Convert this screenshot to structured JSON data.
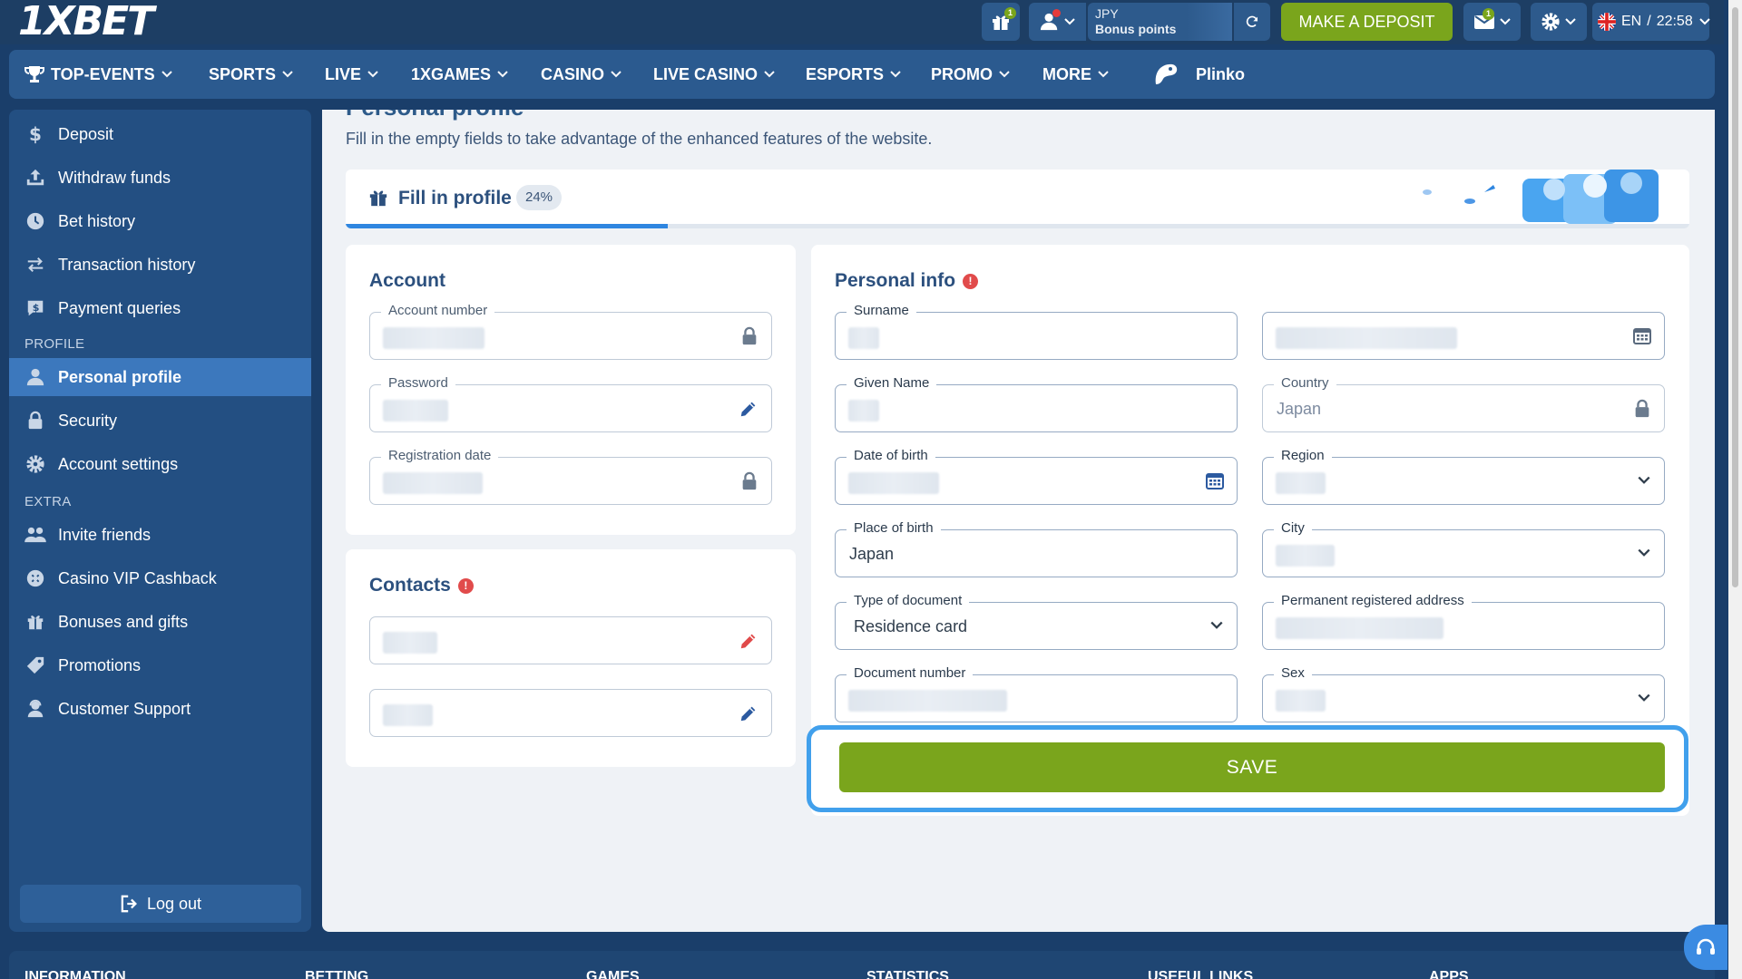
{
  "brand": {
    "logo": "1XBET"
  },
  "header": {
    "gift_badge": "1",
    "balance_currency": "JPY",
    "balance_label": "Bonus points",
    "deposit_label": "MAKE A DEPOSIT",
    "mail_badge": "1",
    "language": "EN",
    "separator": "/",
    "time": "22:58"
  },
  "nav": {
    "items": [
      "TOP-EVENTS",
      "SPORTS",
      "LIVE",
      "1XGAMES",
      "CASINO",
      "LIVE CASINO",
      "ESPORTS",
      "PROMO",
      "MORE"
    ],
    "plinko": "Plinko"
  },
  "sidebar": {
    "items": [
      "Deposit",
      "Withdraw funds",
      "Bet history",
      "Transaction history",
      "Payment queries"
    ],
    "profile_section": "PROFILE",
    "profile_items": [
      "Personal profile",
      "Security",
      "Account settings"
    ],
    "extra_section": "EXTRA",
    "extra_items": [
      "Invite friends",
      "Casino VIP Cashback",
      "Bonuses and gifts",
      "Promotions",
      "Customer Support"
    ],
    "logout": "Log out"
  },
  "main": {
    "title": "Personal profile",
    "subtitle": "Fill in the empty fields to take advantage of the enhanced features of the website.",
    "fill_profile": {
      "title": "Fill in profile",
      "percent": "24%",
      "progress": 0.24
    },
    "account": {
      "title": "Account",
      "account_number_label": "Account number",
      "password_label": "Password",
      "registration_date_label": "Registration date"
    },
    "contacts": {
      "title": "Contacts"
    },
    "personal": {
      "title": "Personal info",
      "surname_label": "Surname",
      "given_name_label": "Given Name",
      "dob_label": "Date of birth",
      "place_of_birth_label": "Place of birth",
      "place_of_birth_value": "Japan",
      "doc_type_label": "Type of document",
      "doc_type_value": "Residence card",
      "doc_number_label": "Document number",
      "country_label": "Country",
      "country_value": "Japan",
      "region_label": "Region",
      "city_label": "City",
      "address_label": "Permanent registered address",
      "sex_label": "Sex"
    },
    "save_label": "SAVE"
  },
  "footer": {
    "columns": [
      "INFORMATION",
      "BETTING",
      "GAMES",
      "STATISTICS",
      "USEFUL LINKS",
      "APPS"
    ]
  },
  "colors": {
    "accent_green": "#7aa51c",
    "header_bg": "#1d3e64",
    "nav_bg": "#2b5a8f",
    "active_blue": "#3c78bd",
    "error_red": "#e14b4b"
  }
}
